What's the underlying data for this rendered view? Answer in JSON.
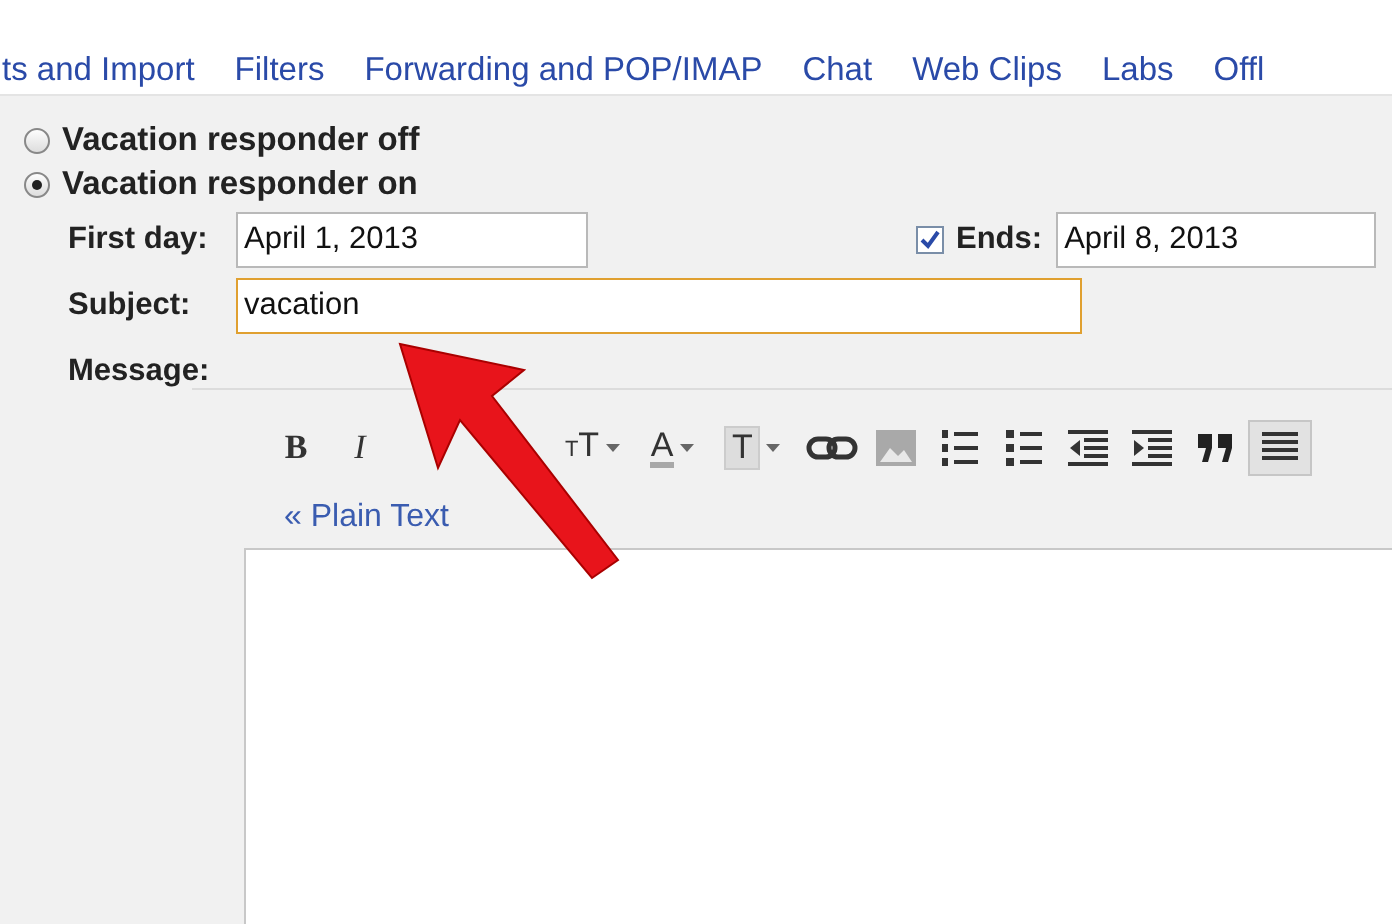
{
  "tabs": [
    {
      "label": "ts and Import",
      "selected": false
    },
    {
      "label": "Filters",
      "selected": false
    },
    {
      "label": "Forwarding and POP/IMAP",
      "selected": false
    },
    {
      "label": "Chat",
      "selected": false
    },
    {
      "label": "Web Clips",
      "selected": false
    },
    {
      "label": "Labs",
      "selected": false
    },
    {
      "label": "Offl",
      "selected": false
    }
  ],
  "responder": [
    {
      "label": "Vacation responder off",
      "selected": false
    },
    {
      "label": "Vacation responder on",
      "selected": true
    }
  ],
  "first_day": {
    "label": "First day:",
    "value": "April 1, 2013"
  },
  "ends": {
    "label": "Ends:",
    "checked": true,
    "value": "April 8, 2013"
  },
  "subject": {
    "label": "Subject:",
    "value": "vacation",
    "focused": true
  },
  "message": {
    "label": "Message:"
  },
  "toolbar": [
    {
      "kind": "bold",
      "label": "B",
      "has_menu": false
    },
    {
      "kind": "italic",
      "label": "I",
      "has_menu": false
    },
    {
      "kind": "size",
      "label": "TT",
      "has_menu": true
    },
    {
      "kind": "color",
      "label": "A",
      "has_menu": true
    },
    {
      "kind": "highlight",
      "label": "T",
      "has_menu": true
    },
    {
      "kind": "link",
      "has_menu": false
    },
    {
      "kind": "image",
      "has_menu": false
    },
    {
      "kind": "numbered",
      "has_menu": false
    },
    {
      "kind": "bullets",
      "has_menu": false
    },
    {
      "kind": "outdent",
      "has_menu": false
    },
    {
      "kind": "indent",
      "has_menu": false
    },
    {
      "kind": "quote",
      "has_menu": false
    },
    {
      "kind": "align",
      "has_menu": false
    }
  ],
  "plain_text_link": "« Plain Text"
}
